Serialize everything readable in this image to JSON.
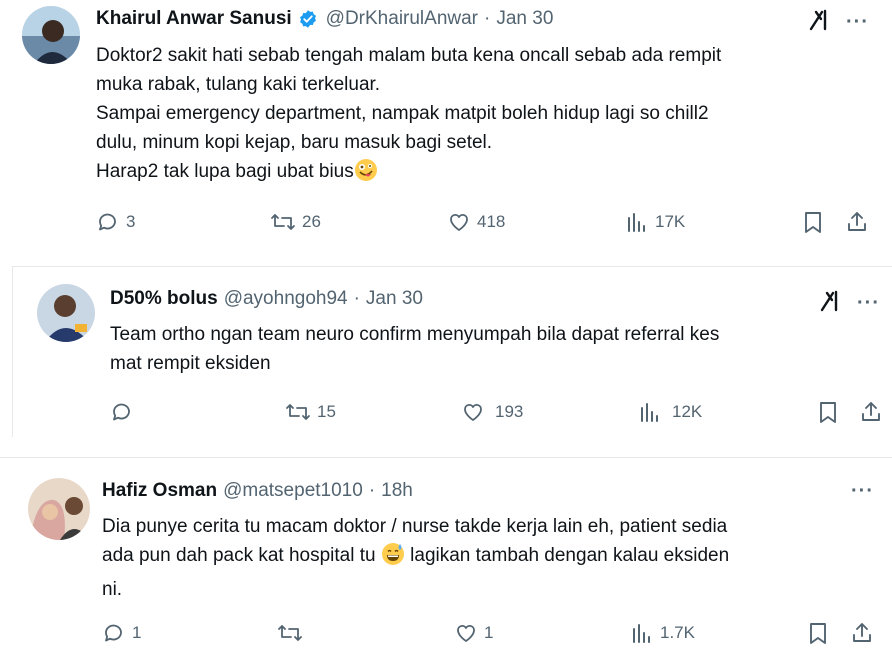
{
  "tweets": [
    {
      "author": "Khairul Anwar Sanusi",
      "verified": true,
      "handle": "@DrKhairulAnwar",
      "time": "Jan 30",
      "lines": [
        "Doktor2 sakit hati sebab tengah malam buta kena oncall sebab ada rempit",
        "muka rabak, tulang kaki terkeluar.",
        "Sampai emergency department, nampak matpit boleh hidup lagi so chill2",
        "dulu, minum kopi kejap, baru masuk bagi setel.",
        "Harap2 tak lupa bagi ubat bius"
      ],
      "emoji": "zany-face",
      "replies": "3",
      "reposts": "26",
      "likes": "418",
      "views": "17K"
    },
    {
      "author": "D50% bolus",
      "handle": "@ayohngoh94",
      "time": "Jan 30",
      "lines": [
        "Team ortho ngan team neuro confirm menyumpah bila dapat referral kes",
        "mat rempit eksiden"
      ],
      "replies": "",
      "reposts": "15",
      "likes": "193",
      "views": "12K"
    },
    {
      "author": "Hafiz Osman",
      "handle": "@matsepet1010",
      "time": "18h",
      "lines": [
        "Dia punye cerita tu macam doktor / nurse takde kerja lain eh, patient sedia",
        "ada pun dah pack kat hospital tu",
        "lagikan tambah dengan kalau eksiden",
        "ni."
      ],
      "emoji": "grinning-sweat-face",
      "replies": "1",
      "reposts": "",
      "likes": "1",
      "views": "1.7K"
    }
  ],
  "sep": "·",
  "icons": {
    "grok": "grok-icon",
    "more": "more-icon",
    "verified_color": "#1d9bf0"
  }
}
